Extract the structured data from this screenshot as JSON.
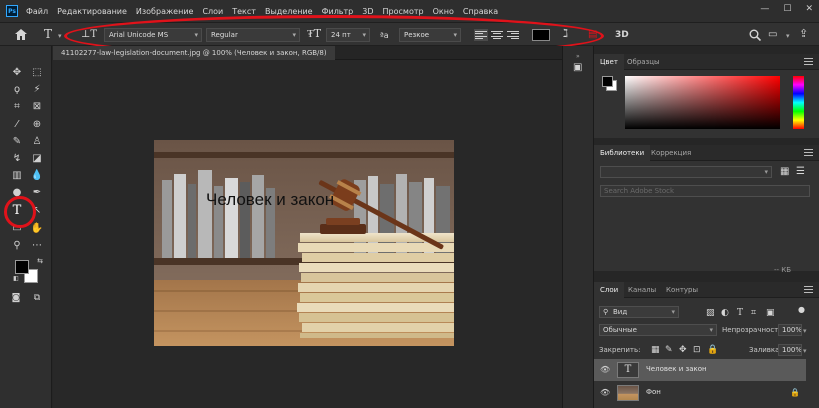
{
  "menubar": {
    "logo": "Ps",
    "items": [
      "Файл",
      "Редактирование",
      "Изображение",
      "Слои",
      "Текст",
      "Выделение",
      "Фильтр",
      "3D",
      "Просмотр",
      "Окно",
      "Справка"
    ],
    "minimize": "—",
    "maximize": "☐",
    "close": "✕"
  },
  "options": {
    "font_family": "Arial Unicode MS",
    "font_style": "Regular",
    "font_size": "24 пт",
    "aa_label": "ªa",
    "antialias": "Резкое",
    "three_d": "3D",
    "text_color": "#000000"
  },
  "document": {
    "tab_title": "41102277-law-legislation-document.jpg @ 100% (Человек и закон, RGB/8)",
    "canvas_text": "Человек и закон"
  },
  "panels": {
    "color": {
      "tabs": [
        "Цвет",
        "Образцы"
      ]
    },
    "libraries": {
      "tabs": [
        "Библиотеки",
        "Коррекция"
      ],
      "search_placeholder": "Search Adobe Stock",
      "size_label": "-- КБ"
    },
    "layers": {
      "tabs": [
        "Слои",
        "Каналы",
        "Контуры"
      ],
      "filter_label": "Вид",
      "blend_mode": "Обычные",
      "opacity_label": "Непрозрачность:",
      "opacity_value": "100%",
      "lock_label": "Закрепить:",
      "fill_label": "Заливка:",
      "fill_value": "100%",
      "items": [
        {
          "name": "Человек и закон",
          "type": "text",
          "thumb": "T"
        },
        {
          "name": "Фон",
          "type": "image"
        }
      ]
    }
  },
  "colors": {
    "annotation": "#e0121a",
    "foreground": "#000000",
    "background": "#ffffff"
  }
}
